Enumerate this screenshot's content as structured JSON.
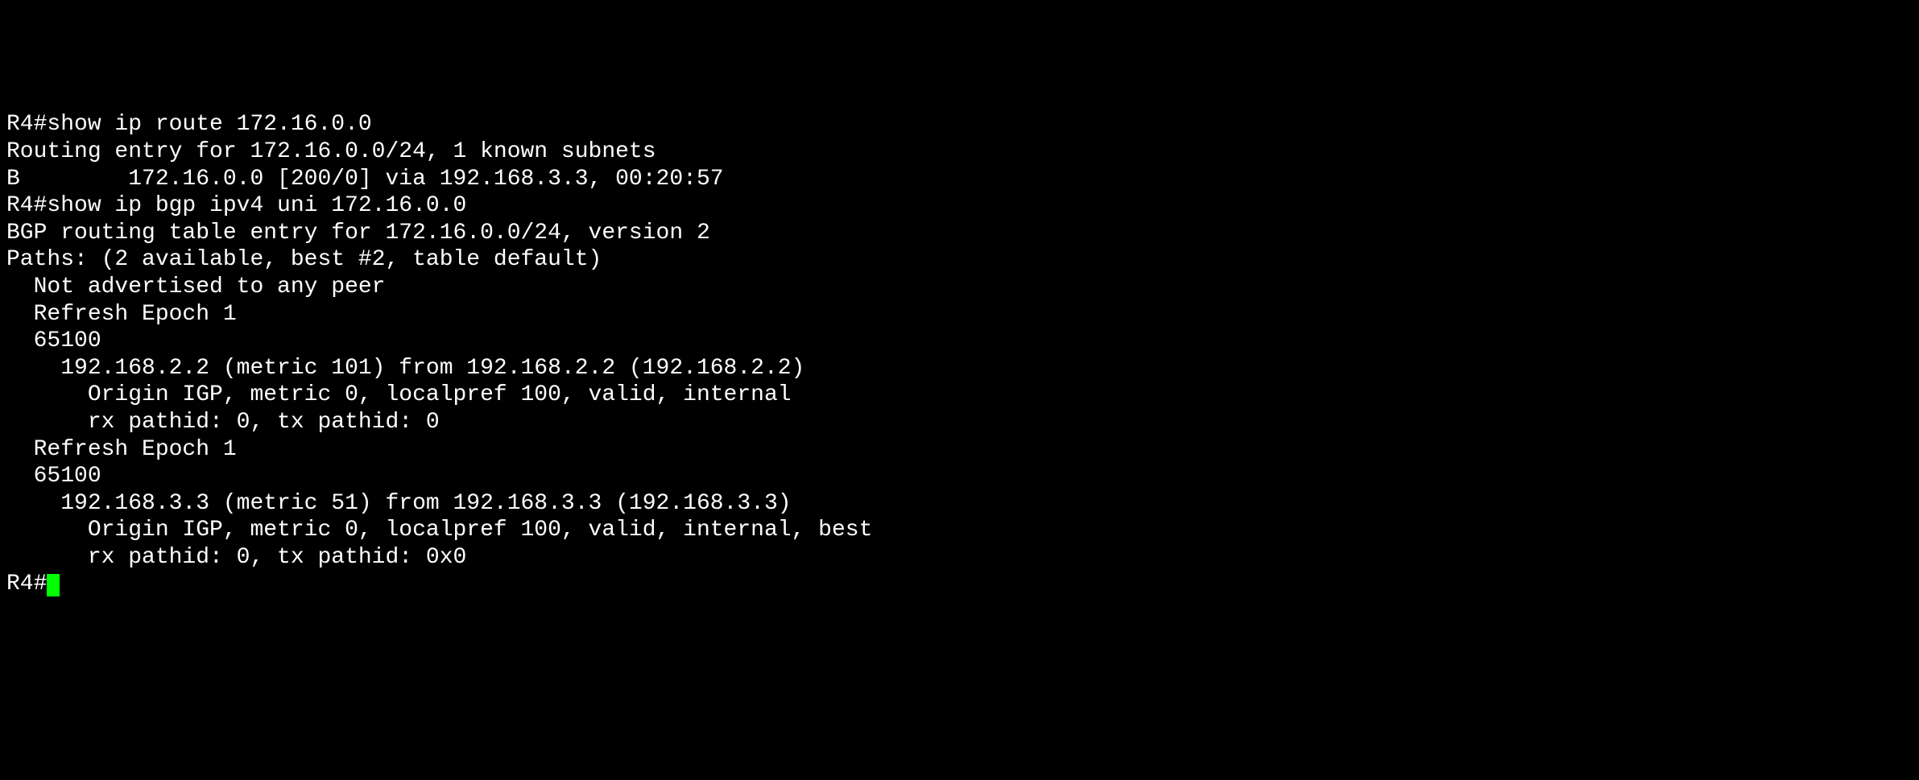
{
  "terminal": {
    "lines": [
      "R4#show ip route 172.16.0.0",
      "Routing entry for 172.16.0.0/24, 1 known subnets",
      "B        172.16.0.0 [200/0] via 192.168.3.3, 00:20:57",
      "R4#show ip bgp ipv4 uni 172.16.0.0",
      "BGP routing table entry for 172.16.0.0/24, version 2",
      "Paths: (2 available, best #2, table default)",
      "  Not advertised to any peer",
      "  Refresh Epoch 1",
      "  65100",
      "    192.168.2.2 (metric 101) from 192.168.2.2 (192.168.2.2)",
      "      Origin IGP, metric 0, localpref 100, valid, internal",
      "      rx pathid: 0, tx pathid: 0",
      "  Refresh Epoch 1",
      "  65100",
      "    192.168.3.3 (metric 51) from 192.168.3.3 (192.168.3.3)",
      "      Origin IGP, metric 0, localpref 100, valid, internal, best",
      "      rx pathid: 0, tx pathid: 0x0",
      "R4#"
    ],
    "prompt": "R4#"
  }
}
